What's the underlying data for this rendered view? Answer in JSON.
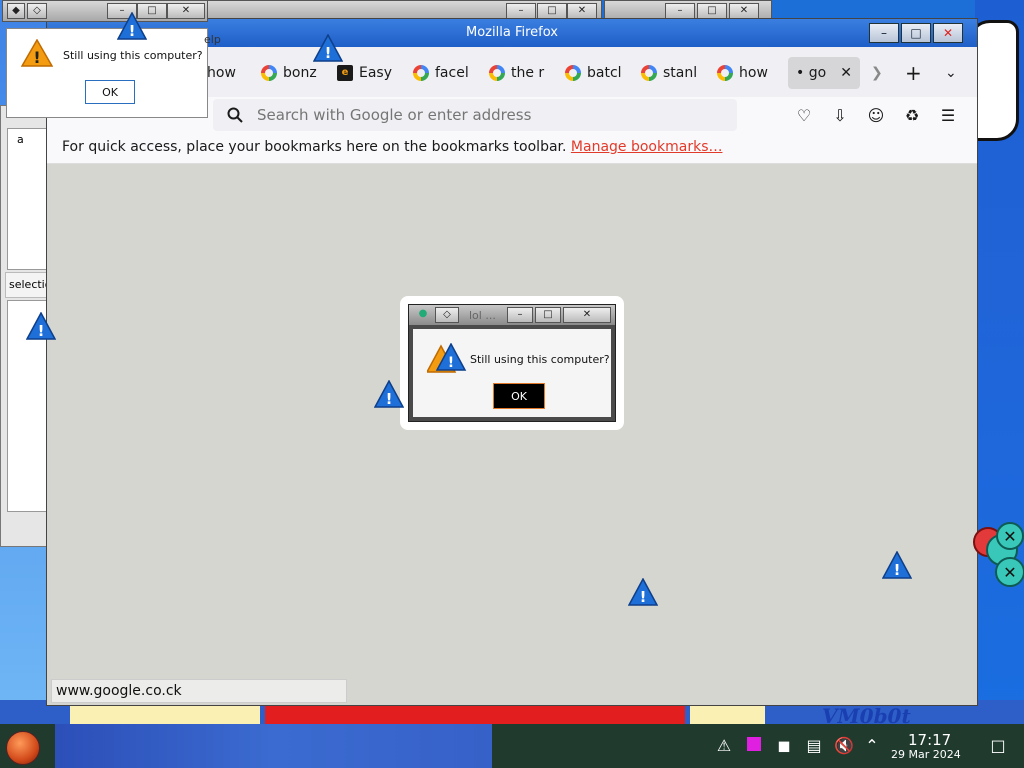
{
  "desktop": {
    "wallpaper_text": "VM0b0t"
  },
  "editor": {
    "text_line": "a",
    "status": "selection"
  },
  "dialog_top": {
    "message": "Still using this computer?",
    "ok_label": "OK",
    "menu_hint": "elp"
  },
  "firefox": {
    "window_title": "Mozilla Firefox",
    "tabs": [
      {
        "label": "how",
        "icon": "google-favicon"
      },
      {
        "label": "bonz",
        "icon": "google-favicon"
      },
      {
        "label": "Easy",
        "icon": "easy-favicon"
      },
      {
        "label": "facel",
        "icon": "google-favicon"
      },
      {
        "label": "the r",
        "icon": "google-favicon"
      },
      {
        "label": "batcl",
        "icon": "google-favicon"
      },
      {
        "label": "stanl",
        "icon": "google-favicon"
      },
      {
        "label": "how",
        "icon": "google-favicon"
      },
      {
        "label": "• go",
        "icon": "none"
      }
    ],
    "address_placeholder": "Search with Google or enter address",
    "bookmarks_message": "For quick access, place your bookmarks here on the bookmarks toolbar.",
    "bookmarks_link": "Manage bookmarks…",
    "status_url": "www.google.co.ck"
  },
  "dialog_center": {
    "title": "lol ...",
    "message": "Still using this computer?",
    "ok_label": "OK"
  },
  "taskbar": {
    "time": "17:17",
    "date": "29 Mar 2024"
  },
  "colors": {
    "accent": "#1f5ec8",
    "link": "#e23a2a",
    "warning_orange": "#f39c12",
    "warning_blue": "#1565c0"
  }
}
